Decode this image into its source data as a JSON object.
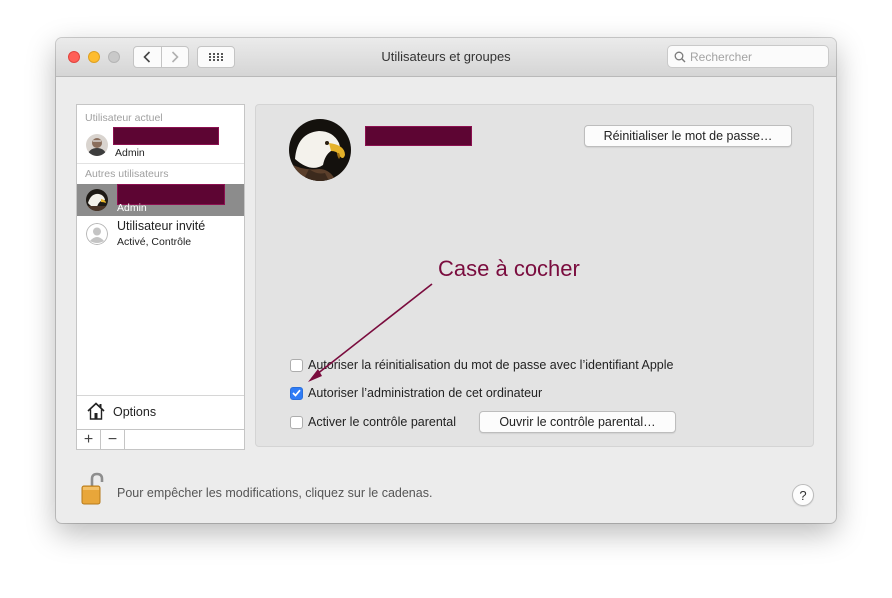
{
  "window": {
    "title": "Utilisateurs et groupes",
    "search_placeholder": "Rechercher"
  },
  "sidebar": {
    "current_user_header": "Utilisateur actuel",
    "current_user_role": "Admin",
    "other_users_header": "Autres utilisateurs",
    "selected_user_role": "Admin",
    "guest_user_name": "Utilisateur invité",
    "guest_user_status": "Activé, Contrôle",
    "options_label": "Options",
    "add_label": "+",
    "remove_label": "−"
  },
  "panel": {
    "reset_password_button": "Réinitialiser le mot de passe…",
    "checkbox_apple_id_label": "Autoriser la réinitialisation du mot de passe avec l’identifiant Apple",
    "checkbox_apple_id_checked": false,
    "checkbox_admin_label": "Autoriser l’administration de cet ordinateur",
    "checkbox_admin_checked": true,
    "checkbox_parental_label": "Activer le contrôle parental",
    "checkbox_parental_checked": false,
    "open_parental_button": "Ouvrir le contrôle parental…"
  },
  "footer": {
    "lock_text": "Pour empêcher les modifications, cliquez sur le cadenas.",
    "help_label": "?"
  },
  "annotation": {
    "text": "Case à cocher"
  },
  "colors": {
    "redaction": "#5d0533",
    "annotation": "#7a0c3e",
    "selection": "#8c8c8c",
    "checkbox_accent": "#2f7cf6"
  }
}
